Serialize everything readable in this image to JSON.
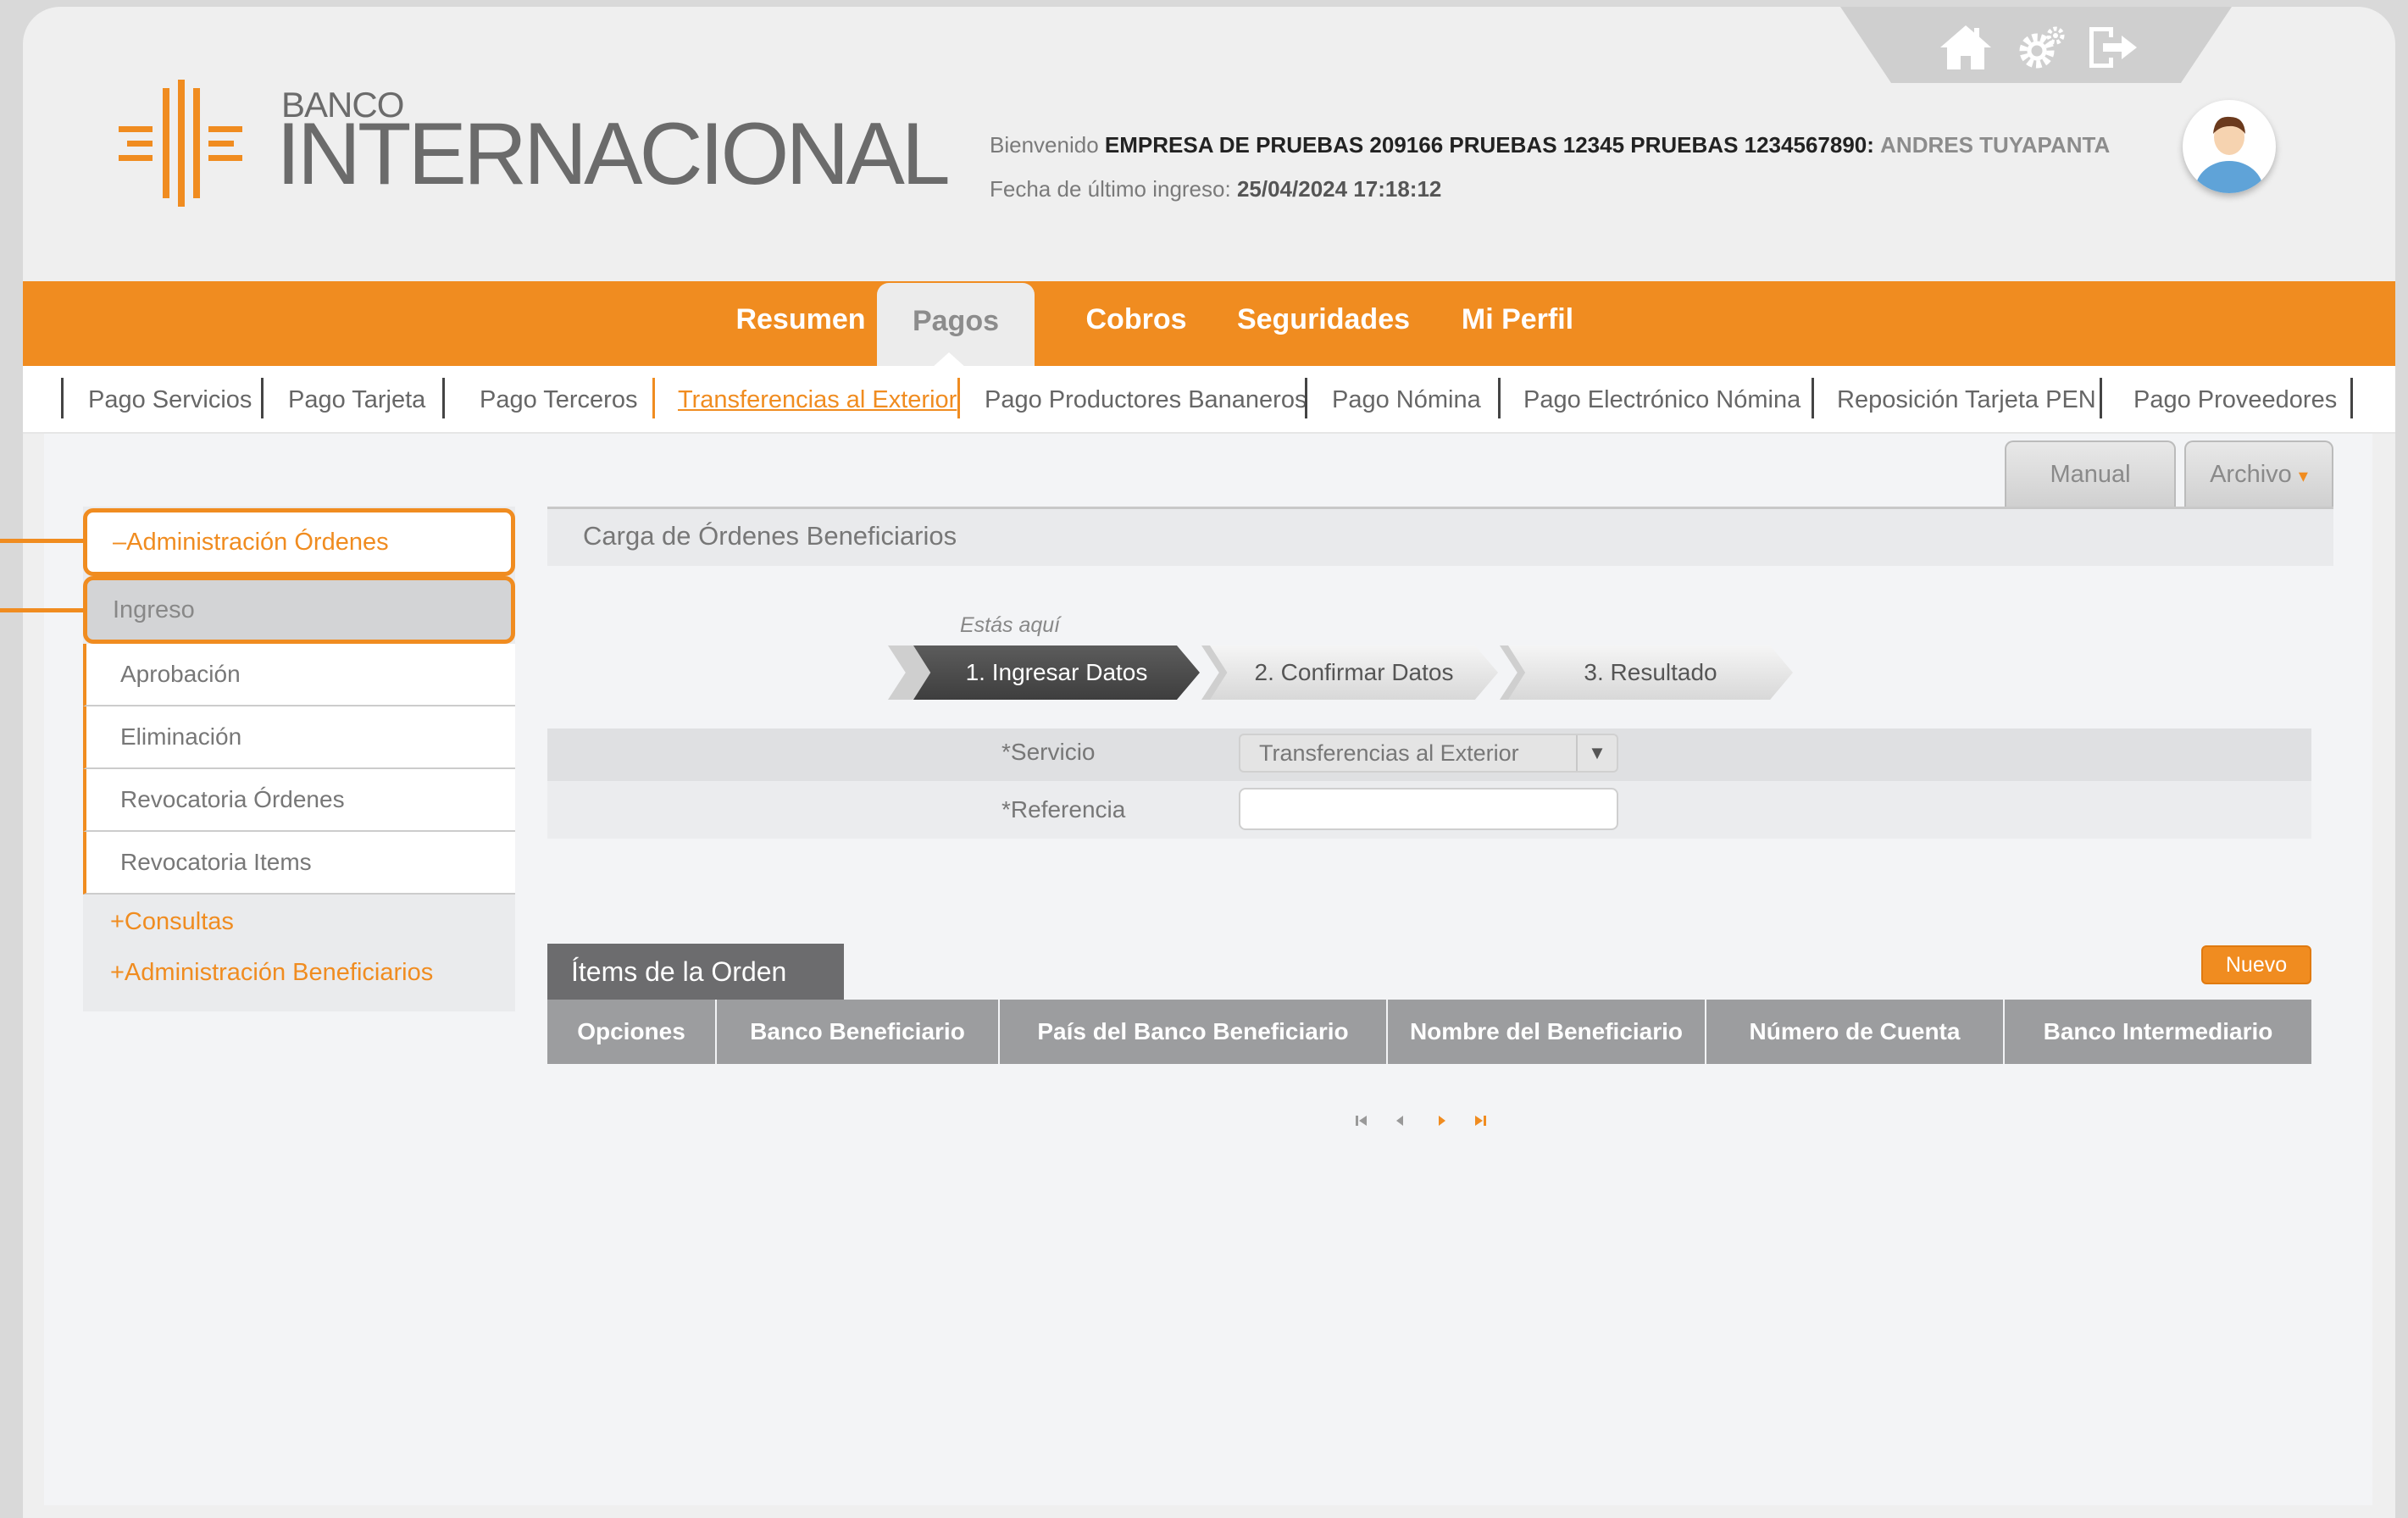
{
  "header": {
    "bank_line1": "BANCO",
    "bank_line2": "INTERNACIONAL",
    "welcome_prefix": "Bienvenido",
    "company": "EMPRESA DE PRUEBAS 209166 PRUEBAS 12345 PRUEBAS 1234567890:",
    "user": "ANDRES TUYAPANTA",
    "last_login_label": "Fecha de último ingreso:",
    "last_login_value": "25/04/2024 17:18:12",
    "icons": [
      "home-icon",
      "settings-icon",
      "logout-icon"
    ]
  },
  "main_nav": [
    "Resumen",
    "Pagos",
    "Cobros",
    "Seguridades",
    "Mi Perfil"
  ],
  "main_nav_active": "Pagos",
  "sub_nav": [
    "Pago Servicios",
    "Pago Tarjeta",
    "Pago Terceros",
    "Transferencias al Exterior",
    "Pago Productores Bananeros",
    "Pago Nómina",
    "Pago Electrónico Nómina",
    "Reposición Tarjeta PEN",
    "Pago Proveedores"
  ],
  "sub_nav_active": "Transferencias al Exterior",
  "toolbar": {
    "manual": "Manual",
    "archivo": "Archivo",
    "archivo_arrow": "▾"
  },
  "page_title": "Carga de Órdenes Beneficiarios",
  "sidebar": {
    "section_open": "–Administración Órdenes",
    "selected": "Ingreso",
    "items": [
      "Aprobación",
      "Eliminación",
      "Revocatoria Órdenes",
      "Revocatoria Items"
    ],
    "collapsed": [
      "+Consultas",
      "+Administración Beneficiarios"
    ]
  },
  "steps": {
    "label": "Estás aquí",
    "items": [
      "1. Ingresar Datos",
      "2. Confirmar Datos",
      "3. Resultado"
    ],
    "current": 1
  },
  "form": {
    "servicio_label": "*Servicio",
    "servicio_value": "Transferencias al Exterior",
    "referencia_label": "*Referencia",
    "referencia_value": ""
  },
  "items_table": {
    "title": "Ítems de la Orden",
    "new_button": "Nuevo",
    "columns": [
      "Opciones",
      "Banco Beneficiario",
      "País del Banco Beneficiario",
      "Nombre del Beneficiario",
      "Número de Cuenta",
      "Banco Intermediario"
    ],
    "rows": []
  },
  "pager": {
    "first": "⏮",
    "prev": "◀",
    "next": "▶",
    "last": "⏭"
  },
  "colors": {
    "accent": "#f08c20",
    "header_bg": "#efefef",
    "table_header": "#9c9d9f"
  }
}
